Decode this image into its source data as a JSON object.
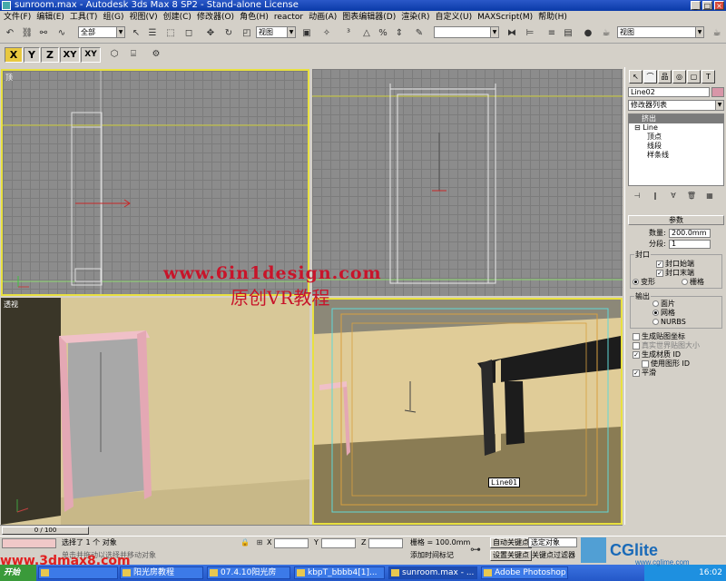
{
  "window": {
    "title": "sunroom.max - Autodesk 3ds Max 8 SP2  - Stand-alone License"
  },
  "menu": [
    "文件(F)",
    "编辑(E)",
    "工具(T)",
    "组(G)",
    "视图(V)",
    "创建(C)",
    "修改器(O)",
    "角色(H)",
    "reactor",
    "动画(A)",
    "图表编辑器(D)",
    "渲染(R)",
    "自定义(U)",
    "MAXScript(M)",
    "帮助(H)"
  ],
  "toolbar": {
    "selection_filter": "全部",
    "ref_coord": "视图",
    "named_selection": "",
    "view_dropdown": "视图"
  },
  "axis_buttons": [
    "X",
    "Y",
    "Z",
    "XY",
    "XY"
  ],
  "viewports": {
    "top_label": "顶",
    "front_label": "",
    "perspective_label": "透视",
    "camera_object_label": "Line01"
  },
  "watermarks": {
    "site_top": "www.6in1design.com",
    "subtitle": "原创VR教程",
    "site_bottom": "www.3dmax8.com",
    "logo": "CGlite",
    "logo_sub": "www.cglime.com"
  },
  "command_panel": {
    "object_name": "Line02",
    "modifier_list": "修改器列表",
    "stack": {
      "selected": "挤出",
      "base": "Line",
      "subs": [
        "顶点",
        "线段",
        "样条线"
      ]
    },
    "params_title": "参数",
    "amount_label": "数量:",
    "amount_value": "200.0mm",
    "segments_label": "分段:",
    "segments_value": "1",
    "capping_label": "封口",
    "cap_start": "封口始端",
    "cap_end": "封口末端",
    "morph": "变形",
    "grid": "栅格",
    "output_label": "输出",
    "patch": "面片",
    "mesh": "网格",
    "nurbs": "NURBS",
    "gen_map": "生成贴图坐标",
    "real_world": "真实世界贴图大小",
    "gen_mat_id": "生成材质 ID",
    "use_shape_id": "使用图形 ID",
    "smooth": "平滑"
  },
  "timeline": {
    "frame": "0 / 100"
  },
  "status": {
    "selected": "选择了 1 个 对象",
    "prompt": "单击并拖动以选择并移动对象",
    "x_label": "X",
    "y_label": "Y",
    "z_label": "Z",
    "grid": "栅格 = 100.0mm",
    "add_time_tag": "添加时间标记",
    "auto_key": "自动关键点",
    "set_key": "设置关键点",
    "selected_obj": "选定对象",
    "key_filters": "关键点过滤器"
  },
  "taskbar": {
    "start": "开始",
    "tasks": [
      "",
      "阳光房教程",
      "07.4.10阳光房",
      "kbpT_bbbb4[1]...",
      "sunroom.max - ...",
      "Adobe Photoshop"
    ],
    "clock": "16:02"
  }
}
